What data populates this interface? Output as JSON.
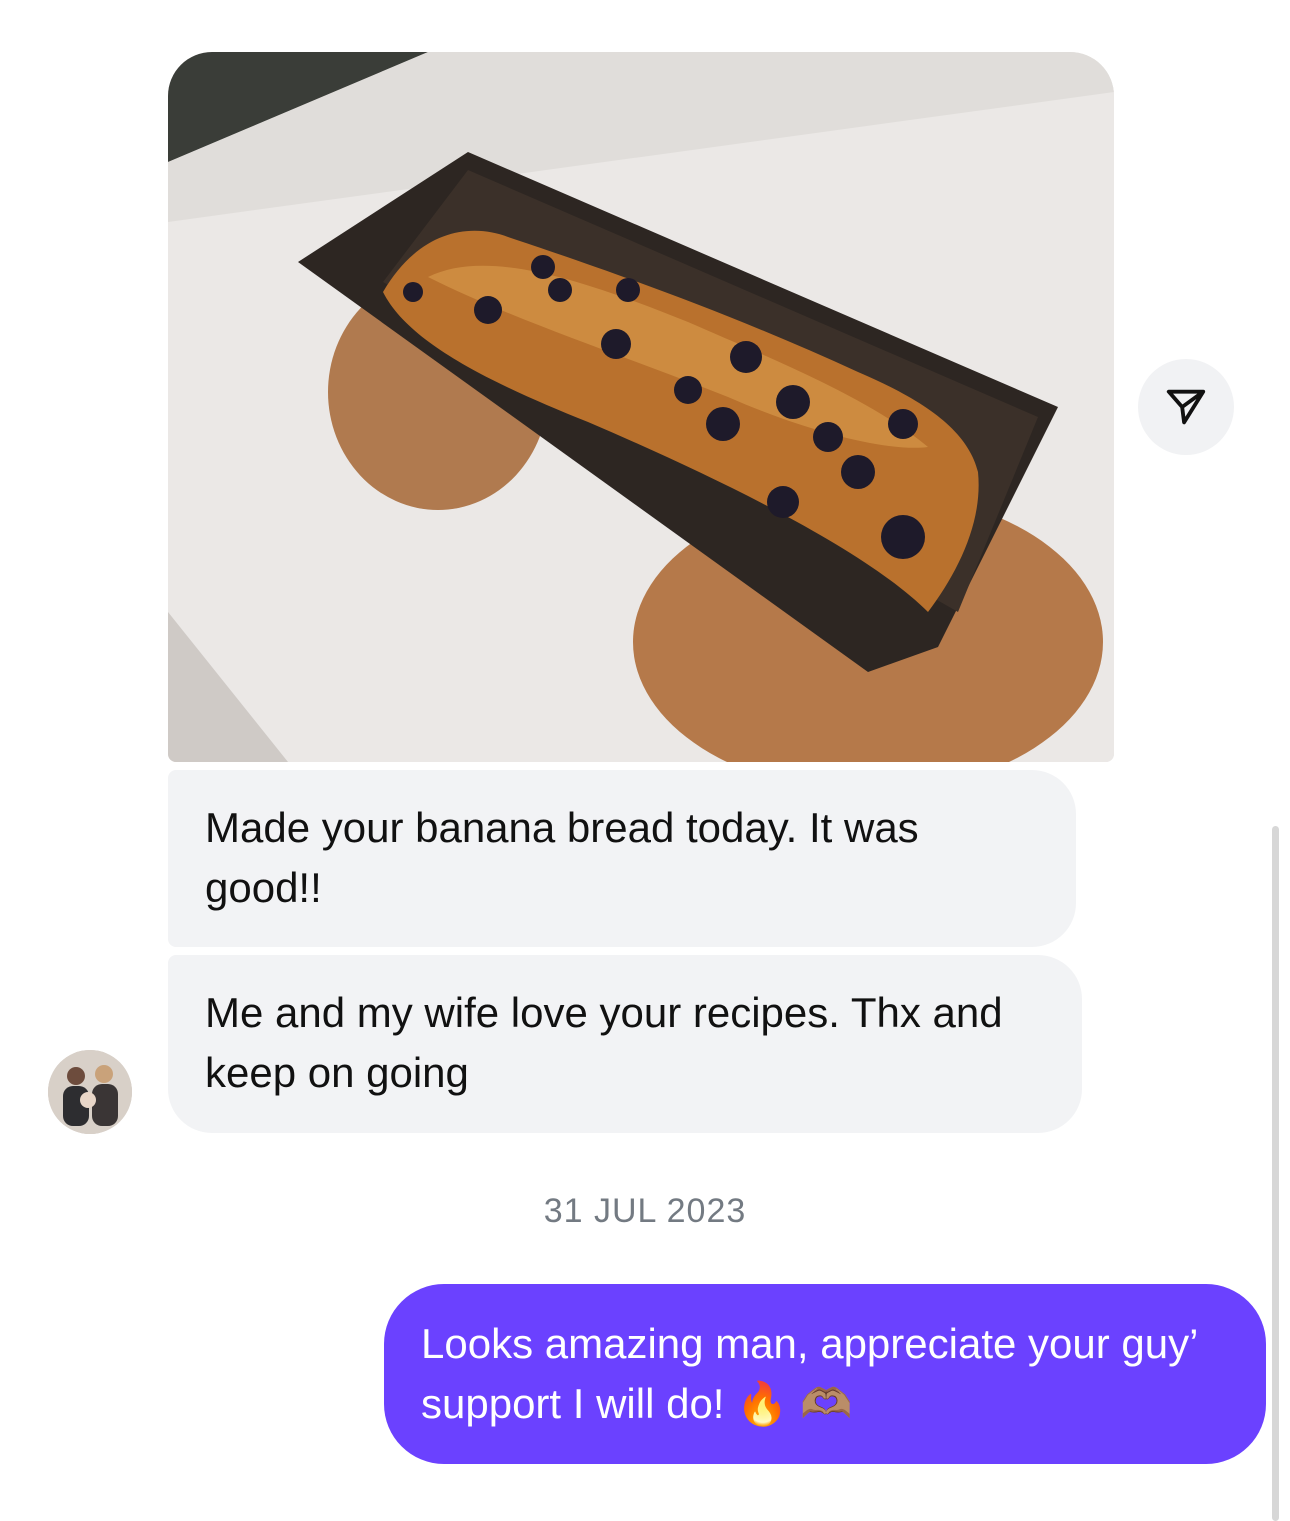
{
  "conversation": {
    "incoming": {
      "photo_alt": "banana bread in loaf pan",
      "messages": [
        {
          "text": "Made your banana bread today. It was good!!"
        },
        {
          "text": "Me and my wife love your recipes. Thx and keep on going"
        }
      ],
      "share_icon": "paper-plane-icon",
      "avatar_icon": "user-avatar"
    },
    "date_separator": "31 JUL 2023",
    "outgoing": {
      "messages": [
        {
          "text": "Looks amazing man, appreciate your guy’ support I will do! 🔥 🫶🏽"
        }
      ]
    }
  },
  "colors": {
    "incoming_bubble": "#f2f3f5",
    "outgoing_bubble": "#6b41ff",
    "date_text": "#737a82"
  }
}
